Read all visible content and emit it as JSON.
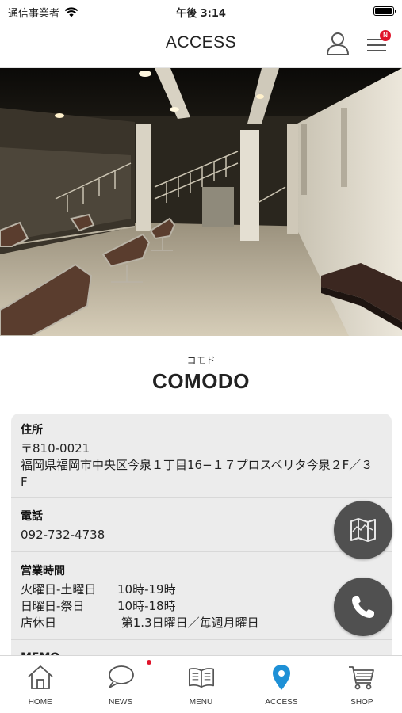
{
  "status_bar": {
    "carrier": "通信事業者",
    "time": "午後 3:14",
    "battery_level": 1.0
  },
  "header": {
    "title": "ACCESS",
    "user_icon": "user-icon",
    "menu_icon": "hamburger-menu-icon",
    "menu_badge": "N"
  },
  "hero": {
    "icon": "salon-interior-photo"
  },
  "shop": {
    "kana": "コモド",
    "name": "COMODO"
  },
  "info": {
    "address": {
      "label": "住所",
      "postal": "〒810-0021",
      "line": "福岡県福岡市中央区今泉１丁目16−１７プロスペリタ今泉２F／３F"
    },
    "phone": {
      "label": "電話",
      "number": "092-732-4738"
    },
    "hours": {
      "label": "営業時間",
      "rows": [
        {
          "day": "火曜日-土曜日",
          "time": "10時-19時"
        },
        {
          "day": "日曜日-祭日",
          "time": "10時-18時"
        },
        {
          "day": "店休日",
          "time": " 第1.3日曜日／毎週月曜日"
        }
      ]
    },
    "memo": {
      "label": "MEMO"
    }
  },
  "fabs": {
    "map_icon": "map-icon",
    "phone_icon": "phone-icon"
  },
  "tabbar": {
    "accent_color": "#1e90d6",
    "items": [
      {
        "label": "HOME",
        "icon": "home-icon",
        "active": false
      },
      {
        "label": "NEWS",
        "icon": "chat-bubble-icon",
        "active": false,
        "has_dot": true
      },
      {
        "label": "MENU",
        "icon": "book-icon",
        "active": false
      },
      {
        "label": "ACCESS",
        "icon": "location-pin-icon",
        "active": true
      },
      {
        "label": "SHOP",
        "icon": "shopping-cart-icon",
        "active": false
      }
    ]
  }
}
